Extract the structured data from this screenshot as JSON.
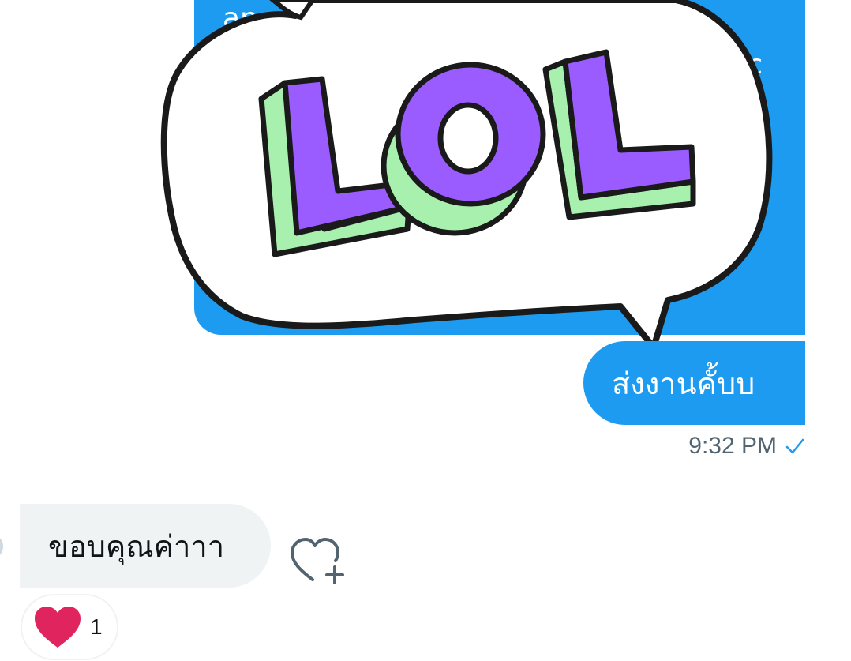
{
  "outgoing_media": {
    "peek_text": "an",
    "peek_text_right": "c"
  },
  "sticker": {
    "text": "LOL",
    "colors": {
      "letters": "#9b5cff",
      "extrusion": "#a8f0ae",
      "outline": "#1a1a1a",
      "bubble": "#ffffff"
    }
  },
  "outgoing_message": {
    "text": "ส่งงานคั้บบ",
    "time": "9:32 PM",
    "status_icon": "check-icon",
    "color": "#1d9bf0"
  },
  "incoming_message": {
    "text": "ขอบคุณค่าาา",
    "color": "#eff3f4"
  },
  "add_reaction_icon": "heart-plus-icon",
  "reaction": {
    "icon": "heart-icon",
    "count": "1",
    "color": "#e0245e"
  }
}
